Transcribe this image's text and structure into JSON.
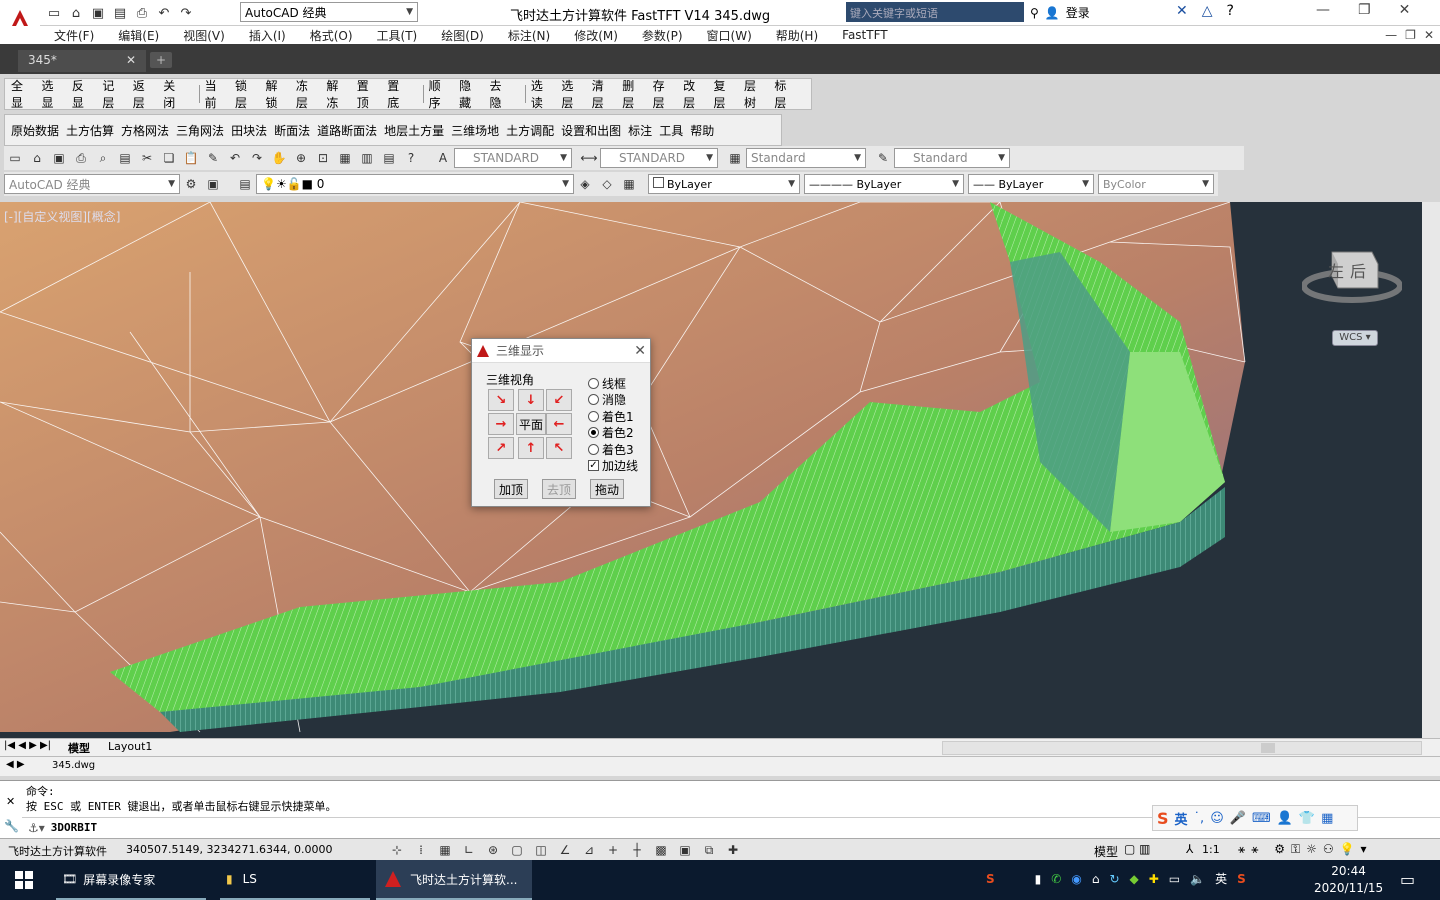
{
  "titlebar": {
    "workspace": "AutoCAD 经典",
    "title": "飞时达土方计算软件 FastTFT V14    345.dwg",
    "search_placeholder": "键入关键字或短语",
    "login": "登录"
  },
  "menus": [
    "文件(F)",
    "编辑(E)",
    "视图(V)",
    "插入(I)",
    "格式(O)",
    "工具(T)",
    "绘图(D)",
    "标注(N)",
    "修改(M)",
    "参数(P)",
    "窗口(W)",
    "帮助(H)",
    "FastTFT"
  ],
  "doc_tab": "345*",
  "layer_toolbar": [
    "全显",
    "选显",
    "反显",
    "记层",
    "返层",
    "关闭",
    "当前",
    "锁层",
    "解锁",
    "冻层",
    "解冻",
    "置顶",
    "置底",
    "顺序",
    "隐藏",
    "去隐",
    "选读",
    "选层",
    "清层",
    "删层",
    "存层",
    "改层",
    "复层",
    "层树",
    "标层"
  ],
  "fast_toolbar": [
    "原始数据",
    "土方估算",
    "方格网法",
    "三角网法",
    "田块法",
    "断面法",
    "道路断面法",
    "地层土方量",
    "三维场地",
    "土方调配",
    "设置和出图",
    "标注",
    "工具",
    "帮助"
  ],
  "styles": {
    "text_style": "STANDARD",
    "dim_style": "STANDARD",
    "table_style": "Standard",
    "mleader_style": "Standard"
  },
  "props": {
    "workspace": "AutoCAD 经典",
    "layer": "0",
    "color": "ByLayer",
    "linetype": "ByLayer",
    "lineweight": "ByLayer",
    "plotstyle": "ByColor"
  },
  "viewport": {
    "label": "[-][自定义视图][概念]",
    "cube_left": "左",
    "cube_back": "后",
    "wcs": "WCS"
  },
  "dialog": {
    "title": "三维显示",
    "group_label": "三维视角",
    "plan_label": "平面",
    "options": [
      "线框",
      "消隐",
      "着色1",
      "着色2",
      "着色3"
    ],
    "selected": "着色2",
    "edge_label": "加边线",
    "edge_checked": true,
    "btn_add": "加顶",
    "btn_remove": "去顶",
    "btn_drag": "拖动"
  },
  "layout_tabs": [
    "模型",
    "Layout1"
  ],
  "file_tab": "345.dwg",
  "command": {
    "line1": "命令:",
    "line2": "按 ESC 或 ENTER 键退出，或者单击鼠标右键显示快捷菜单。",
    "current": "3DORBIT"
  },
  "status": {
    "app": "飞时达土方计算软件",
    "coords": "340507.5149,  3234271.6344,  0.0000",
    "model": "模型",
    "scale": "1:1"
  },
  "ime": {
    "lang": "英"
  },
  "taskbar": {
    "apps": [
      "屏幕录像专家",
      "LS",
      "飞时达土方计算软..."
    ],
    "time": "20:44",
    "date": "2020/11/15",
    "lang": "英"
  }
}
